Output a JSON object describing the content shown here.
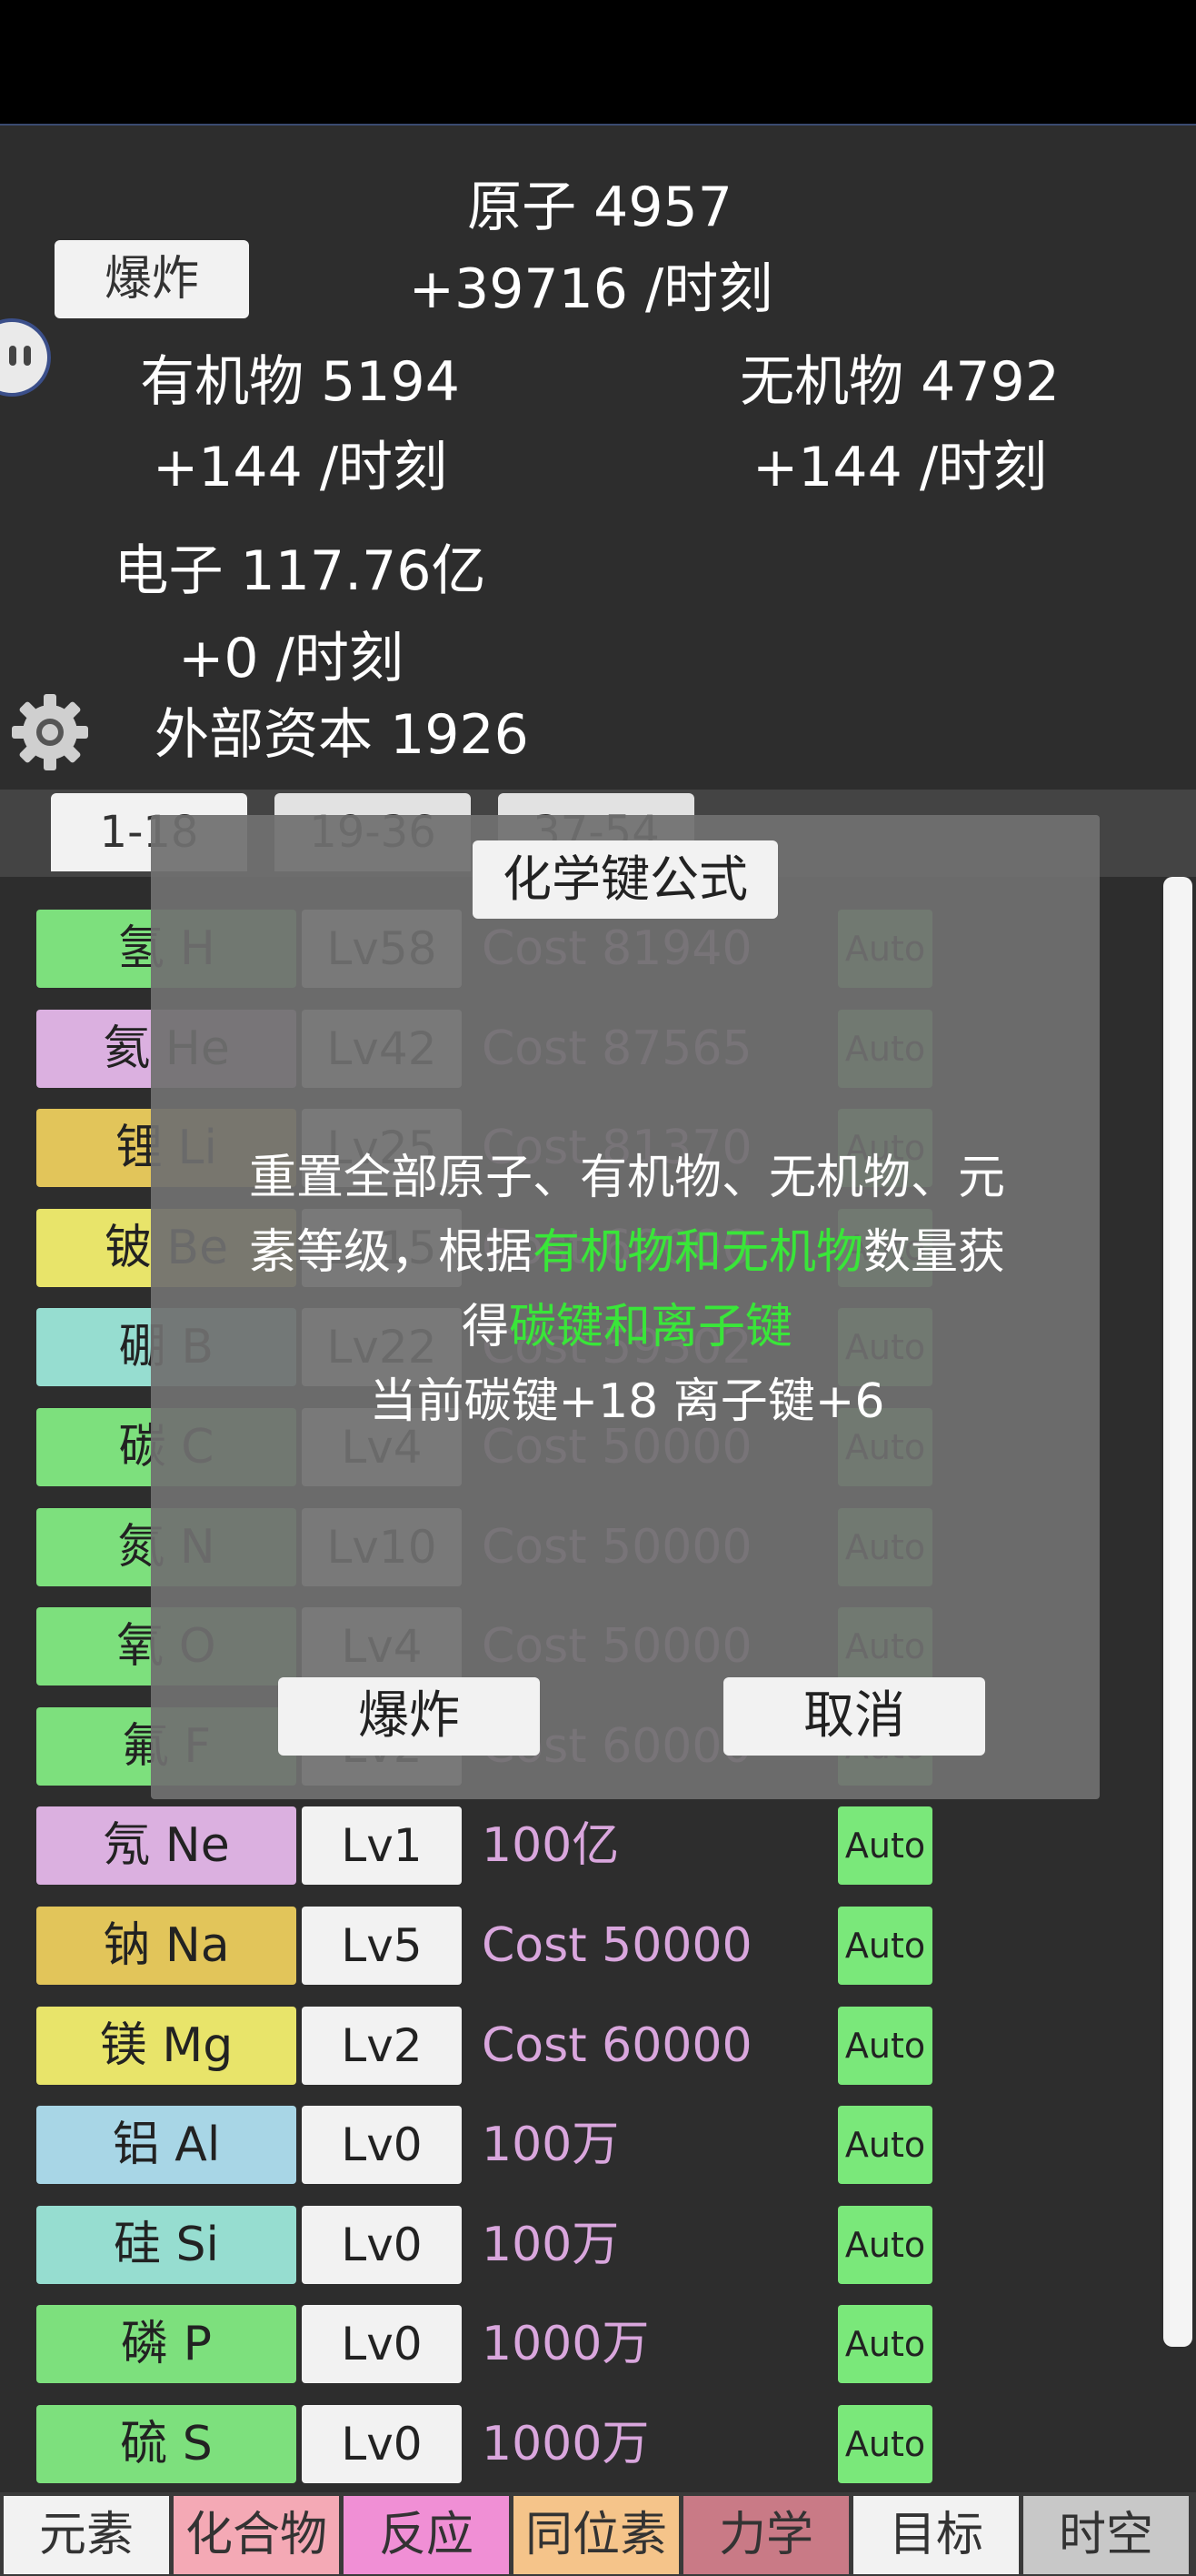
{
  "header": {
    "atoms": "原子 4957",
    "atoms_rate": "+39716 /时刻",
    "explode_label": "爆炸",
    "organic": "有机物 5194",
    "organic_rate": "+144 /时刻",
    "inorganic": "无机物 4792",
    "inorganic_rate": "+144 /时刻",
    "electrons": "电子 117.76亿",
    "electrons_rate": "+0 /时刻",
    "external_capital": "外部资本 1926"
  },
  "range_tabs": [
    "1-18",
    "19-36",
    "37-54"
  ],
  "elements": [
    {
      "name": "氢 H",
      "level": "Lv58",
      "cost": "Cost 81940",
      "auto": "Auto",
      "color": "#7de07d"
    },
    {
      "name": "氦 He",
      "level": "Lv42",
      "cost": "Cost 87565",
      "auto": "Auto",
      "color": "#dbb0e0"
    },
    {
      "name": "锂 Li",
      "level": "Lv25",
      "cost": "Cost 81370",
      "auto": "Auto",
      "color": "#e2c55a"
    },
    {
      "name": "铍 Be",
      "level": "Lv15",
      "cost": "Cost 60000",
      "auto": "Auto",
      "color": "#e8e46a"
    },
    {
      "name": "硼 B",
      "level": "Lv22",
      "cost": "Cost 59302",
      "auto": "Auto",
      "color": "#96ddd0"
    },
    {
      "name": "碳 C",
      "level": "Lv4",
      "cost": "Cost 50000",
      "auto": "Auto",
      "color": "#7de07d"
    },
    {
      "name": "氮 N",
      "level": "Lv10",
      "cost": "Cost 50000",
      "auto": "Auto",
      "color": "#7de07d"
    },
    {
      "name": "氧 O",
      "level": "Lv4",
      "cost": "Cost 50000",
      "auto": "Auto",
      "color": "#7de07d"
    },
    {
      "name": "氟 F",
      "level": "Lv2",
      "cost": "Cost 60000",
      "auto": "Auto",
      "color": "#7de07d"
    },
    {
      "name": "氖 Ne",
      "level": "Lv1",
      "cost": "100亿",
      "auto": "Auto",
      "color": "#dbb0e0"
    },
    {
      "name": "钠 Na",
      "level": "Lv5",
      "cost": "Cost 50000",
      "auto": "Auto",
      "color": "#e2c55a"
    },
    {
      "name": "镁 Mg",
      "level": "Lv2",
      "cost": "Cost 60000",
      "auto": "Auto",
      "color": "#e8e46a"
    },
    {
      "name": "铝 Al",
      "level": "Lv0",
      "cost": "100万",
      "auto": "Auto",
      "color": "#a8d6e6"
    },
    {
      "name": "硅 Si",
      "level": "Lv0",
      "cost": "100万",
      "auto": "Auto",
      "color": "#96ddd0"
    },
    {
      "name": "磷 P",
      "level": "Lv0",
      "cost": "1000万",
      "auto": "Auto",
      "color": "#7de07d"
    },
    {
      "name": "硫 S",
      "level": "Lv0",
      "cost": "1000万",
      "auto": "Auto",
      "color": "#7de07d"
    }
  ],
  "dialog": {
    "title": "化学键公式",
    "line1": "重置全部原子、有机物、无机物、元",
    "line2_pre": "素等级，根据",
    "line2_hl": "有机物和无机物",
    "line2_post": "数量获",
    "line3_pre": "得",
    "line3_hl": "碳键和离子键",
    "line4": "当前碳键+18 离子键+6",
    "confirm_label": "爆炸",
    "cancel_label": "取消"
  },
  "bottom_nav": [
    {
      "label": "元素",
      "color": "#f2f2f2"
    },
    {
      "label": "化合物",
      "color": "#f4a9b5"
    },
    {
      "label": "反应",
      "color": "#f08fd5"
    },
    {
      "label": "同位素",
      "color": "#f5c48a"
    },
    {
      "label": "力学",
      "color": "#c97a86"
    },
    {
      "label": "目标",
      "color": "#f2f2f2"
    },
    {
      "label": "时空",
      "color": "#c8c8c8"
    }
  ]
}
